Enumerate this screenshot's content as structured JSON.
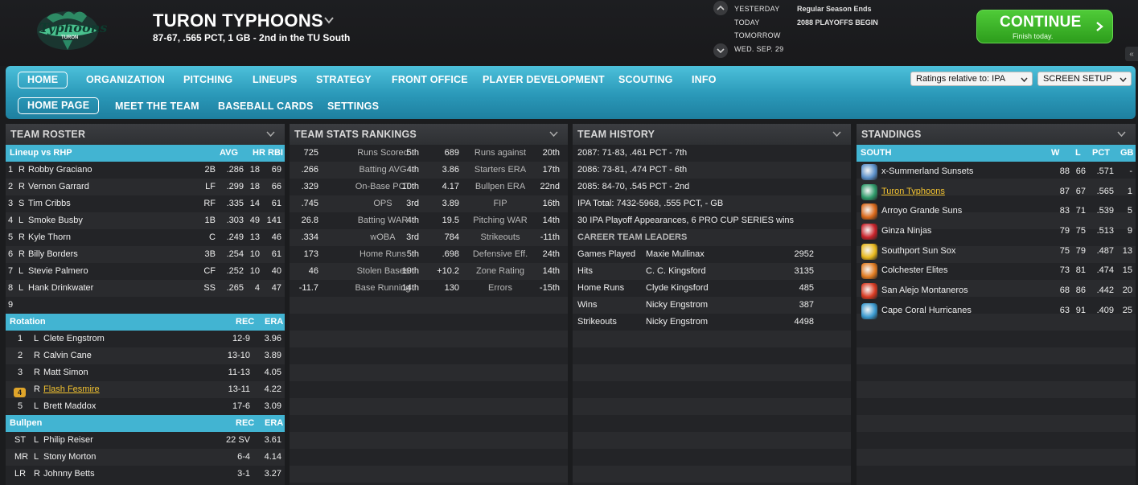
{
  "header": {
    "team_name": "TURON TYPHOONS",
    "record_line": "87-67, .565 PCT, 1 GB - 2nd in the TU South",
    "logo_text": "Typhoons",
    "logo_sub": "TURON",
    "calendar": {
      "labels": [
        "YESTERDAY",
        "TODAY",
        "TOMORROW",
        "WED. SEP. 29"
      ],
      "events": [
        "Regular Season Ends",
        "2088 PLAYOFFS BEGIN"
      ]
    },
    "continue_label": "CONTINUE",
    "continue_sub": "Finish today."
  },
  "nav": {
    "primary": [
      "HOME",
      "ORGANIZATION",
      "PITCHING",
      "LINEUPS",
      "STRATEGY",
      "FRONT OFFICE",
      "PLAYER DEVELOPMENT",
      "SCOUTING",
      "INFO"
    ],
    "secondary": [
      "HOME PAGE",
      "MEET THE TEAM",
      "BASEBALL CARDS",
      "SETTINGS"
    ],
    "ratings_select": "Ratings relative to: IPA",
    "screen_setup": "SCREEN SETUP"
  },
  "roster": {
    "title": "TEAM ROSTER",
    "lineup_header": {
      "label": "Lineup vs RHP",
      "c1": "AVG",
      "c2": "HR",
      "c3": "RBI"
    },
    "lineup": [
      {
        "n": "1",
        "h": "R",
        "name": "Robby Graciano",
        "pos": "2B",
        "avg": ".286",
        "hr": "18",
        "rbi": "69"
      },
      {
        "n": "2",
        "h": "R",
        "name": "Vernon Garrard",
        "pos": "LF",
        "avg": ".299",
        "hr": "18",
        "rbi": "66"
      },
      {
        "n": "3",
        "h": "S",
        "name": "Tim Cribbs",
        "pos": "RF",
        "avg": ".335",
        "hr": "14",
        "rbi": "61"
      },
      {
        "n": "4",
        "h": "L",
        "name": "Smoke Busby",
        "pos": "1B",
        "avg": ".303",
        "hr": "49",
        "rbi": "141"
      },
      {
        "n": "5",
        "h": "R",
        "name": "Kyle Thorn",
        "pos": "C",
        "avg": ".249",
        "hr": "13",
        "rbi": "46"
      },
      {
        "n": "6",
        "h": "R",
        "name": "Billy Borders",
        "pos": "3B",
        "avg": ".254",
        "hr": "10",
        "rbi": "61"
      },
      {
        "n": "7",
        "h": "L",
        "name": "Stevie Palmero",
        "pos": "CF",
        "avg": ".252",
        "hr": "10",
        "rbi": "40"
      },
      {
        "n": "8",
        "h": "L",
        "name": "Hank Drinkwater",
        "pos": "SS",
        "avg": ".265",
        "hr": "4",
        "rbi": "47"
      },
      {
        "n": "9",
        "h": "",
        "name": "",
        "pos": "",
        "avg": "",
        "hr": "",
        "rbi": ""
      }
    ],
    "rotation_header": {
      "label": "Rotation",
      "c1": "REC",
      "c2": "ERA"
    },
    "rotation": [
      {
        "n": "1",
        "h": "L",
        "name": "Clete Engstrom",
        "rec": "12-9",
        "era": "3.96"
      },
      {
        "n": "2",
        "h": "R",
        "name": "Calvin Cane",
        "rec": "13-10",
        "era": "3.89"
      },
      {
        "n": "3",
        "h": "R",
        "name": "Matt Simon",
        "rec": "11-13",
        "era": "4.05"
      },
      {
        "n": "4",
        "h": "R",
        "name": "Flash Fesmire",
        "rec": "13-11",
        "era": "4.22"
      },
      {
        "n": "5",
        "h": "L",
        "name": "Brett Maddox",
        "rec": "17-6",
        "era": "3.09"
      }
    ],
    "bullpen_header": {
      "label": "Bullpen",
      "c1": "REC",
      "c2": "ERA"
    },
    "bullpen": [
      {
        "n": "ST",
        "h": "L",
        "name": "Philip Reiser",
        "rec": "22 SV",
        "era": "3.61"
      },
      {
        "n": "MR",
        "h": "L",
        "name": "Stony Morton",
        "rec": "6-4",
        "era": "4.14"
      },
      {
        "n": "LR",
        "h": "R",
        "name": "Johnny Betts",
        "rec": "3-1",
        "era": "3.27"
      }
    ]
  },
  "stats": {
    "title": "TEAM STATS RANKINGS",
    "rows": [
      [
        "725",
        "Runs Scored",
        "5th",
        "689",
        "Runs against",
        "20th"
      ],
      [
        ".266",
        "Batting AVG",
        "4th",
        "3.86",
        "Starters ERA",
        "17th"
      ],
      [
        ".329",
        "On-Base PCT",
        "10th",
        "4.17",
        "Bullpen ERA",
        "22nd"
      ],
      [
        ".745",
        "OPS",
        "3rd",
        "3.89",
        "FIP",
        "16th"
      ],
      [
        "26.8",
        "Batting WAR",
        "4th",
        "19.5",
        "Pitching WAR",
        "14th"
      ],
      [
        ".334",
        "wOBA",
        "3rd",
        "784",
        "Strikeouts",
        "-11th"
      ],
      [
        "173",
        "Home Runs",
        "5th",
        ".698",
        "Defensive Eff.",
        "24th"
      ],
      [
        "46",
        "Stolen Bases",
        "19th",
        "+10.2",
        "Zone Rating",
        "14th"
      ],
      [
        "-11.7",
        "Base Running",
        "14th",
        "130",
        "Errors",
        "-15th"
      ]
    ]
  },
  "history": {
    "title": "TEAM HISTORY",
    "lines": [
      "2087: 71-83, .461 PCT - 7th",
      "2086: 73-81, .474 PCT - 6th",
      "2085: 84-70, .545 PCT - 2nd",
      "IPA Total: 7432-5968, .555 PCT, - GB",
      "30 IPA Playoff Appearances, 6 PRO CUP SERIES wins"
    ],
    "leaders_title": "CAREER TEAM LEADERS",
    "leaders": [
      {
        "cat": "Games Played",
        "name": "Maxie Mullinax",
        "val": "2952"
      },
      {
        "cat": "Hits",
        "name": "C. C. Kingsford",
        "val": "3135"
      },
      {
        "cat": "Home Runs",
        "name": "Clyde Kingsford",
        "val": "485"
      },
      {
        "cat": "Wins",
        "name": "Nicky Engstrom",
        "val": "387"
      },
      {
        "cat": "Strikeouts",
        "name": "Nicky Engstrom",
        "val": "4498"
      }
    ]
  },
  "standings": {
    "title": "STANDINGS",
    "header": {
      "div": "SOUTH",
      "w": "W",
      "l": "L",
      "pct": "PCT",
      "gb": "GB"
    },
    "teams": [
      {
        "name": "x-Summerland Sunsets",
        "w": "88",
        "l": "66",
        "pct": ".571",
        "gb": "-",
        "color": "#5a8fc8"
      },
      {
        "name": "Turon Typhoons",
        "w": "87",
        "l": "67",
        "pct": ".565",
        "gb": "1",
        "color": "#2e9a6a"
      },
      {
        "name": "Arroyo Grande Suns",
        "w": "83",
        "l": "71",
        "pct": ".539",
        "gb": "5",
        "color": "#d9681a"
      },
      {
        "name": "Ginza Ninjas",
        "w": "79",
        "l": "75",
        "pct": ".513",
        "gb": "9",
        "color": "#c8222a"
      },
      {
        "name": "Southport Sun Sox",
        "w": "75",
        "l": "79",
        "pct": ".487",
        "gb": "13",
        "color": "#e8b81c"
      },
      {
        "name": "Colchester Elites",
        "w": "73",
        "l": "81",
        "pct": ".474",
        "gb": "15",
        "color": "#e07a20"
      },
      {
        "name": "San Alejo Montaneros",
        "w": "68",
        "l": "86",
        "pct": ".442",
        "gb": "20",
        "color": "#d83a22"
      },
      {
        "name": "Cape Coral Hurricanes",
        "w": "63",
        "l": "91",
        "pct": ".409",
        "gb": "25",
        "color": "#3a9ad0"
      }
    ]
  }
}
